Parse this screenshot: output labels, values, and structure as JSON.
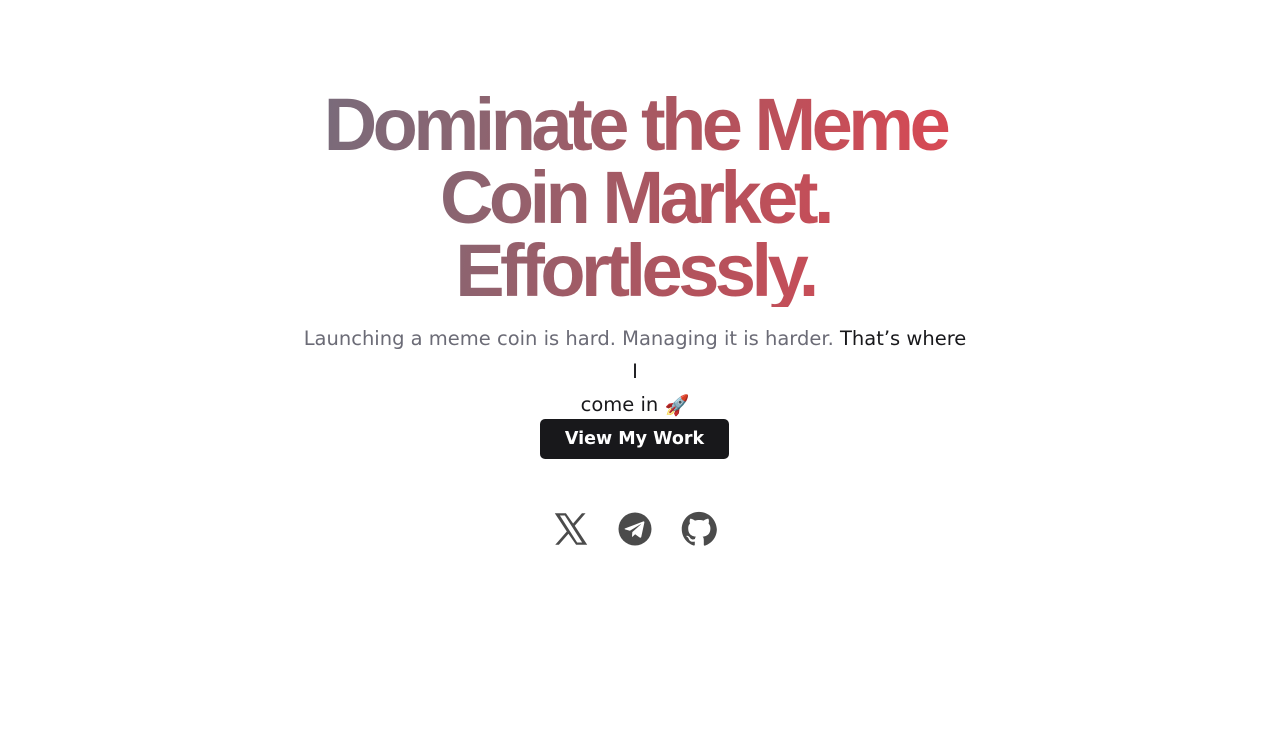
{
  "hero": {
    "headline_lines": [
      "Dominate the Meme",
      "Coin Market.",
      "Effortlessly."
    ],
    "subtitle_muted": "Launching a meme coin is hard. Managing it is harder.",
    "subtitle_dark_1": "That’s where I",
    "subtitle_dark_2": "come in",
    "subtitle_emoji": "🚀",
    "cta_label": "View My Work",
    "gradient_colors": [
      "#6f6f80",
      "#8c6470",
      "#b5525c",
      "#e94550"
    ],
    "accent": "#18181b"
  },
  "socials": [
    {
      "icon": "x-icon"
    },
    {
      "icon": "telegram-icon"
    },
    {
      "icon": "github-icon"
    }
  ]
}
